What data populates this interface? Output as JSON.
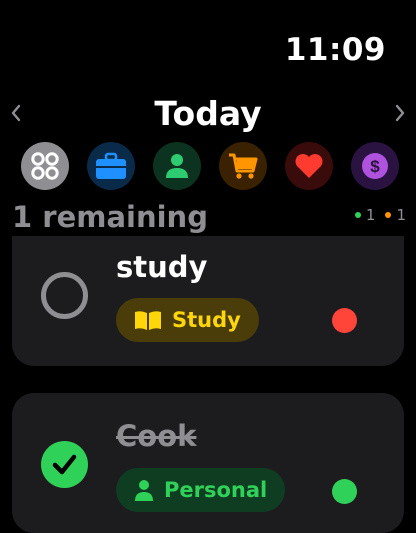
{
  "status_bar": {
    "time": "11:09"
  },
  "header": {
    "title": "Today",
    "prev_icon": "chevron-left-icon",
    "next_icon": "chevron-right-icon"
  },
  "categories": [
    {
      "name": "all",
      "icon": "grid-icon",
      "bg": "#8e8e93",
      "fg": "#ffffff"
    },
    {
      "name": "work",
      "icon": "briefcase-icon",
      "bg": "#0a2a4a",
      "fg": "#1e90ff"
    },
    {
      "name": "personal",
      "icon": "person-icon",
      "bg": "#0c3320",
      "fg": "#2ecc71"
    },
    {
      "name": "shopping",
      "icon": "cart-icon",
      "bg": "#3a2200",
      "fg": "#ff9500"
    },
    {
      "name": "health",
      "icon": "heart-icon",
      "bg": "#3a0b0b",
      "fg": "#ff3b30"
    },
    {
      "name": "finance",
      "icon": "dollar-icon",
      "bg": "#2a1340",
      "fg": "#af52de"
    }
  ],
  "summary": {
    "remaining": "1 remaining",
    "counts": [
      {
        "value": "1",
        "color": "#30d158"
      },
      {
        "value": "1",
        "color": "#ff9500"
      }
    ]
  },
  "tasks": [
    {
      "title": "study",
      "completed": false,
      "tag": {
        "label": "Study",
        "icon": "book-icon",
        "bg": "#4a3d0a",
        "fg": "#ffd60a"
      },
      "priority_color": "#ff453a"
    },
    {
      "title": "Cook",
      "completed": true,
      "tag": {
        "label": "Personal",
        "icon": "person-icon",
        "bg": "#0f3d22",
        "fg": "#30d158"
      },
      "priority_color": "#30d158"
    }
  ]
}
